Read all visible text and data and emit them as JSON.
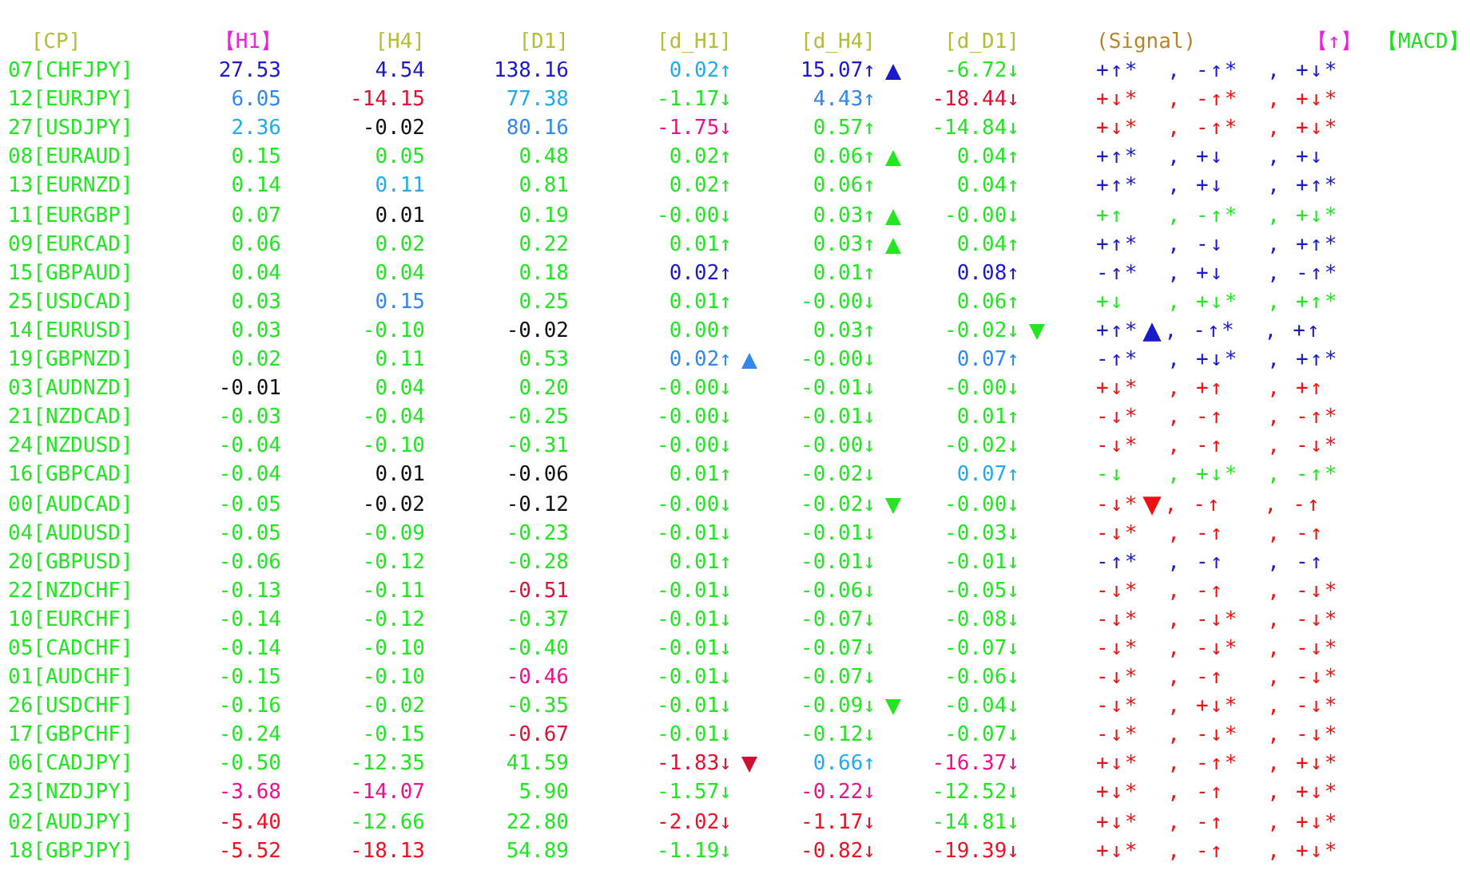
{
  "headers": [
    {
      "text": "[CP]",
      "color": "#b5bd3c"
    },
    {
      "text": "【H1】",
      "color": "#ee22dd"
    },
    {
      "text": "[H4]",
      "color": "#b5bd3c"
    },
    {
      "text": "[D1]",
      "color": "#b5bd3c"
    },
    {
      "text": "[d_H1]",
      "color": "#b5bd3c"
    },
    {
      "text": "[d_H4]",
      "color": "#b5bd3c"
    },
    {
      "text": "[d_D1]",
      "color": "#b5bd3c"
    },
    {
      "text": "(Signal)",
      "color": "#b8862a"
    },
    {
      "text": "【↑】",
      "color": "#ee22dd"
    },
    {
      "text": "【MACD】",
      "color": "#22dd22"
    }
  ],
  "rows": [
    {
      "pair": "07[CHFJPY]",
      "cells": [
        {
          "text": "27.53",
          "color": "#1a1acc"
        },
        {
          "text": "4.54",
          "color": "#1a1acc"
        },
        {
          "text": "138.16",
          "color": "#1a1acc"
        },
        {
          "text": "0.02↑",
          "color": "#22aaee"
        },
        {
          "text": "15.07↑",
          "color": "#1a1acc",
          "marker": {
            "kind": "up",
            "color": "#1a1acc"
          }
        },
        {
          "text": "-6.72↓",
          "color": "#22e622"
        }
      ],
      "signal": {
        "color": "#1a1acc",
        "segments": [
          {
            "kind": "text",
            "text": "+↑*  , -↑*  , +↓*"
          }
        ]
      }
    },
    {
      "pair": "12[EURJPY]",
      "cells": [
        {
          "text": "6.05",
          "color": "#3388ee"
        },
        {
          "text": "-14.15",
          "color": "#dd1133"
        },
        {
          "text": "77.38",
          "color": "#22aaee"
        },
        {
          "text": "-1.17↓",
          "color": "#22e622"
        },
        {
          "text": "4.43↑",
          "color": "#3388ee"
        },
        {
          "text": "-18.44↓",
          "color": "#dd1133"
        }
      ],
      "signal": {
        "color": "#ee1111",
        "segments": [
          {
            "kind": "text",
            "text": "+↓*  , -↑*  , +↓*"
          }
        ]
      }
    },
    {
      "pair": "27[USDJPY]",
      "cells": [
        {
          "text": "2.36",
          "color": "#22aaee"
        },
        {
          "text": "-0.02",
          "color": "#111111"
        },
        {
          "text": "80.16",
          "color": "#3388ee"
        },
        {
          "text": "-1.75↓",
          "color": "#ee1188"
        },
        {
          "text": "0.57↑",
          "color": "#22e622"
        },
        {
          "text": "-14.84↓",
          "color": "#22e622"
        }
      ],
      "signal": {
        "color": "#ee1111",
        "segments": [
          {
            "kind": "text",
            "text": "+↓*  , -↑*  , +↓*"
          }
        ]
      }
    },
    {
      "pair": "08[EURAUD]",
      "cells": [
        {
          "text": "0.15",
          "color": "#22e622"
        },
        {
          "text": "0.05",
          "color": "#22e622"
        },
        {
          "text": "0.48",
          "color": "#22e622"
        },
        {
          "text": "0.02↑",
          "color": "#22e622"
        },
        {
          "text": "0.06↑",
          "color": "#22e622",
          "marker": {
            "kind": "up",
            "color": "#22e622"
          }
        },
        {
          "text": "0.04↑",
          "color": "#22e622"
        }
      ],
      "signal": {
        "color": "#1a1acc",
        "segments": [
          {
            "kind": "text",
            "text": "+↑*  , +↓   , +↓"
          }
        ]
      }
    },
    {
      "pair": "13[EURNZD]",
      "cells": [
        {
          "text": "0.14",
          "color": "#22e622"
        },
        {
          "text": "0.11",
          "color": "#22aaee"
        },
        {
          "text": "0.81",
          "color": "#22e622"
        },
        {
          "text": "0.02↑",
          "color": "#22e622"
        },
        {
          "text": "0.06↑",
          "color": "#22e622"
        },
        {
          "text": "0.04↑",
          "color": "#22e622"
        }
      ],
      "signal": {
        "color": "#1a1acc",
        "segments": [
          {
            "kind": "text",
            "text": "+↑*  , +↓   , +↑*"
          }
        ]
      }
    },
    {
      "pair": "11[EURGBP]",
      "cells": [
        {
          "text": "0.07",
          "color": "#22e622"
        },
        {
          "text": "0.01",
          "color": "#111111"
        },
        {
          "text": "0.19",
          "color": "#22e622"
        },
        {
          "text": "-0.00↓",
          "color": "#22e622"
        },
        {
          "text": "0.03↑",
          "color": "#22e622",
          "marker": {
            "kind": "up",
            "color": "#22e622"
          }
        },
        {
          "text": "-0.00↓",
          "color": "#22e622"
        }
      ],
      "signal": {
        "color": "#22e622",
        "segments": [
          {
            "kind": "text",
            "text": "+↑   , -↑*  , +↓*"
          }
        ]
      }
    },
    {
      "pair": "09[EURCAD]",
      "cells": [
        {
          "text": "0.06",
          "color": "#22e622"
        },
        {
          "text": "0.02",
          "color": "#22e622"
        },
        {
          "text": "0.22",
          "color": "#22e622"
        },
        {
          "text": "0.01↑",
          "color": "#22e622"
        },
        {
          "text": "0.03↑",
          "color": "#22e622",
          "marker": {
            "kind": "up",
            "color": "#22e622"
          }
        },
        {
          "text": "0.04↑",
          "color": "#22e622"
        }
      ],
      "signal": {
        "color": "#1a1acc",
        "segments": [
          {
            "kind": "text",
            "text": "+↑*  , -↓   , +↑*"
          }
        ]
      }
    },
    {
      "pair": "15[GBPAUD]",
      "cells": [
        {
          "text": "0.04",
          "color": "#22e622"
        },
        {
          "text": "0.04",
          "color": "#22e622"
        },
        {
          "text": "0.18",
          "color": "#22e622"
        },
        {
          "text": "0.02↑",
          "color": "#1a1acc"
        },
        {
          "text": "0.01↑",
          "color": "#22e622"
        },
        {
          "text": "0.08↑",
          "color": "#1a1acc"
        }
      ],
      "signal": {
        "color": "#1a1acc",
        "segments": [
          {
            "kind": "text",
            "text": "-↑*  , +↓   , -↑*"
          }
        ]
      }
    },
    {
      "pair": "25[USDCAD]",
      "cells": [
        {
          "text": "0.03",
          "color": "#22e622"
        },
        {
          "text": "0.15",
          "color": "#3388ee"
        },
        {
          "text": "0.25",
          "color": "#22e622"
        },
        {
          "text": "0.01↑",
          "color": "#22e622"
        },
        {
          "text": "-0.00↓",
          "color": "#22e622"
        },
        {
          "text": "0.06↑",
          "color": "#22e622"
        }
      ],
      "signal": {
        "color": "#22e622",
        "segments": [
          {
            "kind": "text",
            "text": "+↓   , +↓*  , +↑*"
          }
        ]
      }
    },
    {
      "pair": "14[EURUSD]",
      "cells": [
        {
          "text": "0.03",
          "color": "#22e622"
        },
        {
          "text": "-0.10",
          "color": "#22e622"
        },
        {
          "text": "-0.02",
          "color": "#111111"
        },
        {
          "text": "0.00↑",
          "color": "#22e622"
        },
        {
          "text": "0.03↑",
          "color": "#22e622"
        },
        {
          "text": "-0.02↓",
          "color": "#22e622",
          "marker": {
            "kind": "down",
            "color": "#22e622"
          }
        }
      ],
      "signal": {
        "color": "#1a1acc",
        "segments": [
          {
            "kind": "text",
            "text": "+↑*"
          },
          {
            "kind": "up",
            "color": "#1a1acc"
          },
          {
            "kind": "text",
            "text": ", -↑*  , +↑"
          }
        ]
      }
    },
    {
      "pair": "19[GBPNZD]",
      "cells": [
        {
          "text": "0.02",
          "color": "#22e622"
        },
        {
          "text": "0.11",
          "color": "#22e622"
        },
        {
          "text": "0.53",
          "color": "#22e622"
        },
        {
          "text": "0.02↑",
          "color": "#3388ee",
          "marker": {
            "kind": "up",
            "color": "#3388ee"
          }
        },
        {
          "text": "-0.00↓",
          "color": "#22e622"
        },
        {
          "text": "0.07↑",
          "color": "#3388ee"
        }
      ],
      "signal": {
        "color": "#1a1acc",
        "segments": [
          {
            "kind": "text",
            "text": "-↑*  , +↓*  , +↑*"
          }
        ]
      }
    },
    {
      "pair": "03[AUDNZD]",
      "cells": [
        {
          "text": "-0.01",
          "color": "#111111"
        },
        {
          "text": "0.04",
          "color": "#22e622"
        },
        {
          "text": "0.20",
          "color": "#22e622"
        },
        {
          "text": "-0.00↓",
          "color": "#22e622"
        },
        {
          "text": "-0.01↓",
          "color": "#22e622"
        },
        {
          "text": "-0.00↓",
          "color": "#22e622"
        }
      ],
      "signal": {
        "color": "#ee1111",
        "segments": [
          {
            "kind": "text",
            "text": "+↓*  , +↑   , +↑"
          }
        ]
      }
    },
    {
      "pair": "21[NZDCAD]",
      "cells": [
        {
          "text": "-0.03",
          "color": "#22e622"
        },
        {
          "text": "-0.04",
          "color": "#22e622"
        },
        {
          "text": "-0.25",
          "color": "#22e622"
        },
        {
          "text": "-0.00↓",
          "color": "#22e622"
        },
        {
          "text": "-0.01↓",
          "color": "#22e622"
        },
        {
          "text": "0.01↑",
          "color": "#22e622"
        }
      ],
      "signal": {
        "color": "#ee1111",
        "segments": [
          {
            "kind": "text",
            "text": "-↓*  , -↑   , -↑*"
          }
        ]
      }
    },
    {
      "pair": "24[NZDUSD]",
      "cells": [
        {
          "text": "-0.04",
          "color": "#22e622"
        },
        {
          "text": "-0.10",
          "color": "#22e622"
        },
        {
          "text": "-0.31",
          "color": "#22e622"
        },
        {
          "text": "-0.00↓",
          "color": "#22e622"
        },
        {
          "text": "-0.00↓",
          "color": "#22e622"
        },
        {
          "text": "-0.02↓",
          "color": "#22e622"
        }
      ],
      "signal": {
        "color": "#ee1111",
        "segments": [
          {
            "kind": "text",
            "text": "-↓*  , -↑   , -↓*"
          }
        ]
      }
    },
    {
      "pair": "16[GBPCAD]",
      "cells": [
        {
          "text": "-0.04",
          "color": "#22e622"
        },
        {
          "text": "0.01",
          "color": "#111111"
        },
        {
          "text": "-0.06",
          "color": "#111111"
        },
        {
          "text": "0.01↑",
          "color": "#22e622"
        },
        {
          "text": "-0.02↓",
          "color": "#22e622"
        },
        {
          "text": "0.07↑",
          "color": "#22aaee"
        }
      ],
      "signal": {
        "color": "#22e622",
        "segments": [
          {
            "kind": "text",
            "text": "-↓   , +↓*  , -↑*"
          }
        ]
      }
    },
    {
      "pair": "00[AUDCAD]",
      "cells": [
        {
          "text": "-0.05",
          "color": "#22e622"
        },
        {
          "text": "-0.02",
          "color": "#111111"
        },
        {
          "text": "-0.12",
          "color": "#111111"
        },
        {
          "text": "-0.00↓",
          "color": "#22e622"
        },
        {
          "text": "-0.02↓",
          "color": "#22e622",
          "marker": {
            "kind": "down",
            "color": "#22e622"
          }
        },
        {
          "text": "-0.00↓",
          "color": "#22e622"
        }
      ],
      "signal": {
        "color": "#ee1111",
        "segments": [
          {
            "kind": "text",
            "text": "-↓*"
          },
          {
            "kind": "down",
            "color": "#ee1111"
          },
          {
            "kind": "text",
            "text": ", -↑   , -↑"
          }
        ]
      }
    },
    {
      "pair": "04[AUDUSD]",
      "cells": [
        {
          "text": "-0.05",
          "color": "#22e622"
        },
        {
          "text": "-0.09",
          "color": "#22e622"
        },
        {
          "text": "-0.23",
          "color": "#22e622"
        },
        {
          "text": "-0.01↓",
          "color": "#22e622"
        },
        {
          "text": "-0.01↓",
          "color": "#22e622"
        },
        {
          "text": "-0.03↓",
          "color": "#22e622"
        }
      ],
      "signal": {
        "color": "#ee1111",
        "segments": [
          {
            "kind": "text",
            "text": "-↓*  , -↑   , -↑"
          }
        ]
      }
    },
    {
      "pair": "20[GBPUSD]",
      "cells": [
        {
          "text": "-0.06",
          "color": "#22e622"
        },
        {
          "text": "-0.12",
          "color": "#22e622"
        },
        {
          "text": "-0.28",
          "color": "#22e622"
        },
        {
          "text": "0.01↑",
          "color": "#22e622"
        },
        {
          "text": "-0.01↓",
          "color": "#22e622"
        },
        {
          "text": "-0.01↓",
          "color": "#22e622"
        }
      ],
      "signal": {
        "color": "#1a1acc",
        "segments": [
          {
            "kind": "text",
            "text": "-↑*  , -↑   , -↑"
          }
        ]
      }
    },
    {
      "pair": "22[NZDCHF]",
      "cells": [
        {
          "text": "-0.13",
          "color": "#22e622"
        },
        {
          "text": "-0.11",
          "color": "#22e622"
        },
        {
          "text": "-0.51",
          "color": "#dd1133"
        },
        {
          "text": "-0.01↓",
          "color": "#22e622"
        },
        {
          "text": "-0.06↓",
          "color": "#22e622"
        },
        {
          "text": "-0.05↓",
          "color": "#22e622"
        }
      ],
      "signal": {
        "color": "#ee1111",
        "segments": [
          {
            "kind": "text",
            "text": "-↓*  , -↑   , -↓*"
          }
        ]
      }
    },
    {
      "pair": "10[EURCHF]",
      "cells": [
        {
          "text": "-0.14",
          "color": "#22e622"
        },
        {
          "text": "-0.12",
          "color": "#22e622"
        },
        {
          "text": "-0.37",
          "color": "#22e622"
        },
        {
          "text": "-0.01↓",
          "color": "#22e622"
        },
        {
          "text": "-0.07↓",
          "color": "#22e622"
        },
        {
          "text": "-0.08↓",
          "color": "#22e622"
        }
      ],
      "signal": {
        "color": "#ee1111",
        "segments": [
          {
            "kind": "text",
            "text": "-↓*  , -↓*  , -↓*"
          }
        ]
      }
    },
    {
      "pair": "05[CADCHF]",
      "cells": [
        {
          "text": "-0.14",
          "color": "#22e622"
        },
        {
          "text": "-0.10",
          "color": "#22e622"
        },
        {
          "text": "-0.40",
          "color": "#22e622"
        },
        {
          "text": "-0.01↓",
          "color": "#22e622"
        },
        {
          "text": "-0.07↓",
          "color": "#22e622"
        },
        {
          "text": "-0.07↓",
          "color": "#22e622"
        }
      ],
      "signal": {
        "color": "#ee1111",
        "segments": [
          {
            "kind": "text",
            "text": "-↓*  , -↓*  , -↓*"
          }
        ]
      }
    },
    {
      "pair": "01[AUDCHF]",
      "cells": [
        {
          "text": "-0.15",
          "color": "#22e622"
        },
        {
          "text": "-0.10",
          "color": "#22e622"
        },
        {
          "text": "-0.46",
          "color": "#ee1188"
        },
        {
          "text": "-0.01↓",
          "color": "#22e622"
        },
        {
          "text": "-0.07↓",
          "color": "#22e622"
        },
        {
          "text": "-0.06↓",
          "color": "#22e622"
        }
      ],
      "signal": {
        "color": "#ee1111",
        "segments": [
          {
            "kind": "text",
            "text": "-↓*  , -↑   , -↓*"
          }
        ]
      }
    },
    {
      "pair": "26[USDCHF]",
      "cells": [
        {
          "text": "-0.16",
          "color": "#22e622"
        },
        {
          "text": "-0.02",
          "color": "#22e622"
        },
        {
          "text": "-0.35",
          "color": "#22e622"
        },
        {
          "text": "-0.01↓",
          "color": "#22e622"
        },
        {
          "text": "-0.09↓",
          "color": "#22e622",
          "marker": {
            "kind": "down",
            "color": "#22e622"
          }
        },
        {
          "text": "-0.04↓",
          "color": "#22e622"
        }
      ],
      "signal": {
        "color": "#ee1111",
        "segments": [
          {
            "kind": "text",
            "text": "-↓*  , +↓*  , -↓*"
          }
        ]
      }
    },
    {
      "pair": "17[GBPCHF]",
      "cells": [
        {
          "text": "-0.24",
          "color": "#22e622"
        },
        {
          "text": "-0.15",
          "color": "#22e622"
        },
        {
          "text": "-0.67",
          "color": "#dd1133"
        },
        {
          "text": "-0.01↓",
          "color": "#22e622"
        },
        {
          "text": "-0.12↓",
          "color": "#22e622"
        },
        {
          "text": "-0.07↓",
          "color": "#22e622"
        }
      ],
      "signal": {
        "color": "#ee1111",
        "segments": [
          {
            "kind": "text",
            "text": "-↓*  , -↓*  , -↓*"
          }
        ]
      }
    },
    {
      "pair": "06[CADJPY]",
      "cells": [
        {
          "text": "-0.50",
          "color": "#22e622"
        },
        {
          "text": "-12.35",
          "color": "#22e622"
        },
        {
          "text": "41.59",
          "color": "#22e622"
        },
        {
          "text": "-1.83↓",
          "color": "#dd1133",
          "marker": {
            "kind": "down",
            "color": "#cc1133"
          }
        },
        {
          "text": "0.66↑",
          "color": "#22aaee"
        },
        {
          "text": "-16.37↓",
          "color": "#ee1188"
        }
      ],
      "signal": {
        "color": "#ee1111",
        "segments": [
          {
            "kind": "text",
            "text": "+↓*  , -↑*  , +↓*"
          }
        ]
      }
    },
    {
      "pair": "23[NZDJPY]",
      "cells": [
        {
          "text": "-3.68",
          "color": "#ee1188"
        },
        {
          "text": "-14.07",
          "color": "#ee1188"
        },
        {
          "text": "5.90",
          "color": "#22e622"
        },
        {
          "text": "-1.57↓",
          "color": "#22e622"
        },
        {
          "text": "-0.22↓",
          "color": "#ee1188"
        },
        {
          "text": "-12.52↓",
          "color": "#22e622"
        }
      ],
      "signal": {
        "color": "#ee1111",
        "segments": [
          {
            "kind": "text",
            "text": "+↓*  , -↑   , +↓*"
          }
        ]
      }
    },
    {
      "pair": "02[AUDJPY]",
      "cells": [
        {
          "text": "-5.40",
          "color": "#ee1122"
        },
        {
          "text": "-12.66",
          "color": "#22e622"
        },
        {
          "text": "22.80",
          "color": "#22e622"
        },
        {
          "text": "-2.02↓",
          "color": "#ee1122"
        },
        {
          "text": "-1.17↓",
          "color": "#ee1122"
        },
        {
          "text": "-14.81↓",
          "color": "#22e622"
        }
      ],
      "signal": {
        "color": "#ee1111",
        "segments": [
          {
            "kind": "text",
            "text": "+↓*  , -↑   , +↓*"
          }
        ]
      }
    },
    {
      "pair": "18[GBPJPY]",
      "cells": [
        {
          "text": "-5.52",
          "color": "#ee1122"
        },
        {
          "text": "-18.13",
          "color": "#ee1122"
        },
        {
          "text": "54.89",
          "color": "#22e622"
        },
        {
          "text": "-1.19↓",
          "color": "#22e622"
        },
        {
          "text": "-0.82↓",
          "color": "#ee1122"
        },
        {
          "text": "-19.39↓",
          "color": "#ee1122"
        }
      ],
      "signal": {
        "color": "#ee1111",
        "segments": [
          {
            "kind": "text",
            "text": "+↓*  , -↑   , +↓*"
          }
        ]
      }
    }
  ]
}
